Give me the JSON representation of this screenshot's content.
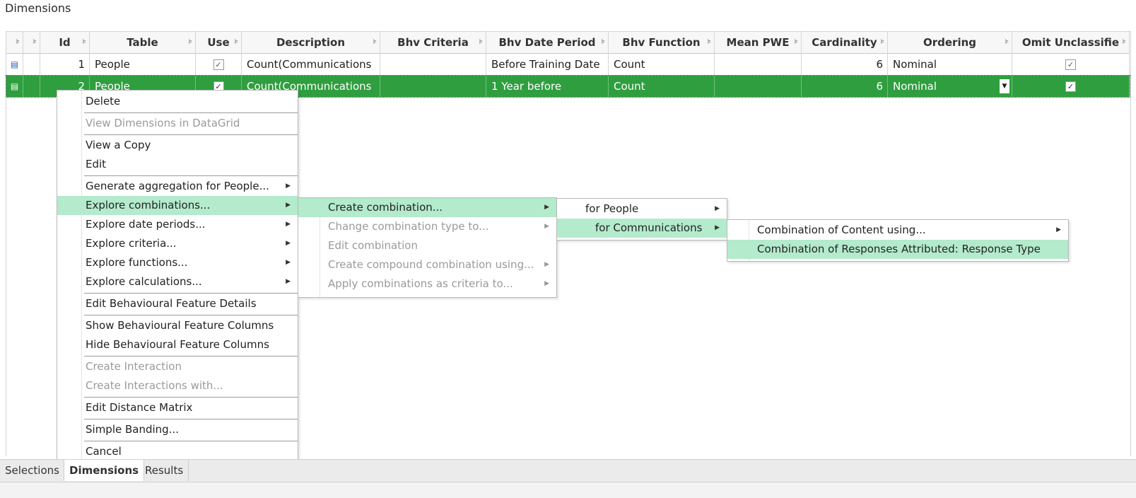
{
  "panel": {
    "title": "Dimensions"
  },
  "grid": {
    "columns": [
      "Id",
      "Table",
      "Use",
      "Description",
      "Bhv Criteria",
      "Bhv Date Period",
      "Bhv Function",
      "Mean PWE",
      "Cardinality",
      "Ordering",
      "Omit Unclassifie"
    ],
    "rows": [
      {
        "id": "1",
        "table": "People",
        "use": true,
        "description": "Count(Communications",
        "bhv_criteria": "",
        "bhv_date_period": "Before Training Date",
        "bhv_function": "Count",
        "mean_pwe": "",
        "cardinality": "6",
        "ordering": "Nominal",
        "omit_unclassified": true
      },
      {
        "id": "2",
        "table": "People",
        "use": true,
        "description": "Count(Communications",
        "bhv_criteria": "",
        "bhv_date_period": "1 Year before",
        "bhv_function": "Count",
        "mean_pwe": "",
        "cardinality": "6",
        "ordering": "Nominal",
        "omit_unclassified": true
      }
    ],
    "selected_row_color": "#2f9e3f"
  },
  "context_menu": {
    "items": [
      {
        "label": "Delete",
        "enabled": true
      },
      {
        "label": "View Dimensions in DataGrid",
        "enabled": false
      },
      {
        "label": "View a Copy",
        "enabled": true
      },
      {
        "label": "Edit",
        "enabled": true
      },
      {
        "label": "Generate aggregation for People...",
        "enabled": true,
        "submenu": true
      },
      {
        "label": "Explore combinations...",
        "enabled": true,
        "submenu": true,
        "highlighted": true
      },
      {
        "label": "Explore date periods...",
        "enabled": true,
        "submenu": true
      },
      {
        "label": "Explore criteria...",
        "enabled": true,
        "submenu": true
      },
      {
        "label": "Explore functions...",
        "enabled": true,
        "submenu": true
      },
      {
        "label": "Explore calculations...",
        "enabled": true,
        "submenu": true
      },
      {
        "label": "Edit Behavioural Feature Details",
        "enabled": true
      },
      {
        "label": "Show Behavioural Feature Columns",
        "enabled": true
      },
      {
        "label": "Hide Behavioural Feature Columns",
        "enabled": true
      },
      {
        "label": "Create Interaction",
        "enabled": false
      },
      {
        "label": "Create Interactions with...",
        "enabled": false
      },
      {
        "label": "Edit Distance Matrix",
        "enabled": true
      },
      {
        "label": "Simple Banding...",
        "enabled": true
      },
      {
        "label": "Cancel",
        "enabled": true
      }
    ]
  },
  "submenu_combinations": {
    "items": [
      {
        "label": "Create combination...",
        "enabled": true,
        "submenu": true,
        "highlighted": true
      },
      {
        "label": "Change combination type to...",
        "enabled": false,
        "submenu": true
      },
      {
        "label": "Edit combination",
        "enabled": false
      },
      {
        "label": "Create compound combination using...",
        "enabled": false,
        "submenu": true
      },
      {
        "label": "Apply combinations as criteria to...",
        "enabled": false,
        "submenu": true
      }
    ]
  },
  "submenu_create": {
    "items": [
      {
        "label": "for People",
        "submenu": true
      },
      {
        "label": "for Communications",
        "submenu": true,
        "highlighted": true
      }
    ]
  },
  "submenu_for_communications": {
    "items": [
      {
        "label": "Combination of Content using...",
        "submenu": true
      },
      {
        "label": "Combination of Responses Attributed: Response Type",
        "highlighted": true
      }
    ]
  },
  "tabs": {
    "items": [
      "Selections",
      "Dimensions",
      "Results"
    ],
    "active": "Dimensions"
  },
  "colors": {
    "menu_highlight": "#b3ebcc",
    "selected_row": "#2f9e3f"
  }
}
